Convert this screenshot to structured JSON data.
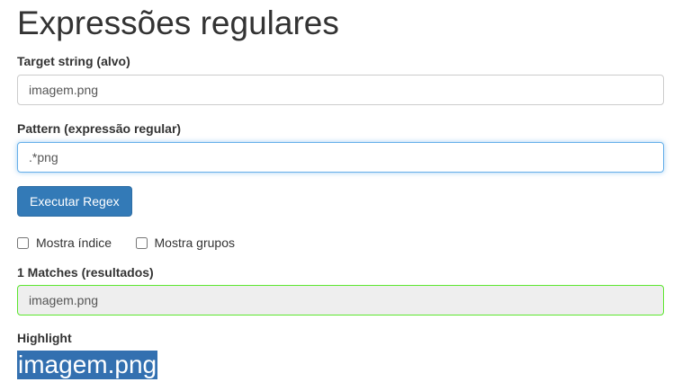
{
  "title": "Expressões regulares",
  "target": {
    "label": "Target string (alvo)",
    "value": "imagem.png"
  },
  "pattern": {
    "label": "Pattern (expressão regular)",
    "value": ".*png"
  },
  "button": "Executar Regex",
  "checkboxes": [
    {
      "label": "Mostra índice",
      "checked": false
    },
    {
      "label": "Mostra grupos",
      "checked": false
    }
  ],
  "matches": {
    "label": "1 Matches (resultados)",
    "value": "imagem.png"
  },
  "highlight": {
    "label": "Highlight",
    "value": "imagem.png"
  },
  "colors": {
    "accent": "#337ab7",
    "match_border": "#5ce62e"
  }
}
